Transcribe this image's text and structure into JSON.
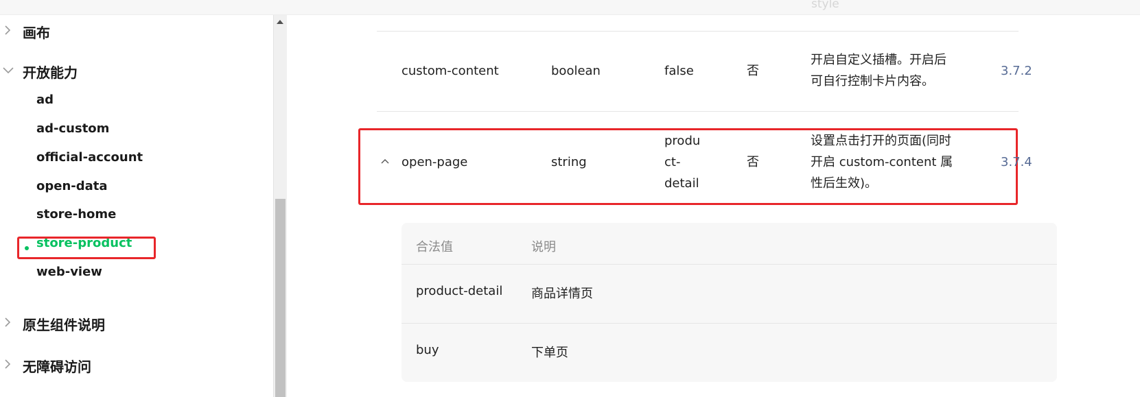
{
  "topbar": {
    "faded_text": "style"
  },
  "sidebar": {
    "sections": [
      {
        "label": "画布",
        "expanded": false
      },
      {
        "label": "开放能力",
        "expanded": true
      },
      {
        "label": "原生组件说明",
        "expanded": false
      },
      {
        "label": "无障碍访问",
        "expanded": false
      }
    ],
    "sub_items": [
      "ad",
      "ad-custom",
      "official-account",
      "open-data",
      "store-home",
      "store-product",
      "web-view"
    ],
    "active_item": "store-product"
  },
  "table": {
    "rows": [
      {
        "name": "custom-content",
        "type": "boolean",
        "default": "false",
        "required": "否",
        "description_lines": [
          "开启自定义插槽。开启后",
          "可自行控制卡片内容。"
        ],
        "version": "3.7.2"
      },
      {
        "name": "open-page",
        "type": "string",
        "default_lines": [
          "produ",
          "ct-",
          "detail"
        ],
        "required": "否",
        "description_lines": [
          "设置点击打开的页面(同时",
          "开启 custom-content 属",
          "性后生效)。"
        ],
        "version": "3.7.4"
      }
    ]
  },
  "subtable": {
    "headers": [
      "合法值",
      "说明"
    ],
    "rows": [
      {
        "value": "product-detail",
        "description": "商品详情页"
      },
      {
        "value": "buy",
        "description": "下单页"
      }
    ]
  },
  "colors": {
    "accent_green": "#07c160",
    "highlight_red": "#e8262a",
    "link_blue": "#576b95"
  }
}
